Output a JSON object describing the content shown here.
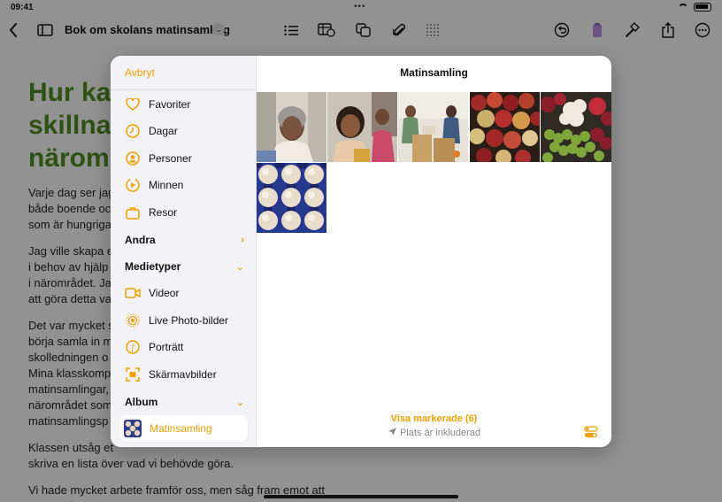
{
  "status": {
    "time": "09:41"
  },
  "toolbar": {
    "title": "Bok om skolans matinsamling",
    "icons": [
      "back-icon",
      "sidebar-icon",
      "list-icon",
      "table-icon",
      "shapes-icon",
      "paperclip-icon",
      "grid-icon",
      "undo-icon",
      "color-icon",
      "hammer-icon",
      "share-icon",
      "more-icon"
    ]
  },
  "document": {
    "heading": "Hur ka\nskillnad\nnärom",
    "paragraphs": [
      "Varje dag ser jag\nbåde boende oc\nsom är hungriga",
      "Jag ville skapa e\ni behov av hjälp\ni närområdet. Ja\natt göra detta va",
      "Det var mycket s\nbörja samla in m\nskolledningen o\nMina klasskomp\nmatinsamlingar,\nnärområdet som\nmatinsamlingsp",
      "Klassen utsåg et\nskriva en lista över vad vi behövde göra.",
      "Vi hade mycket arbete framför oss, men såg fram emot att\ngöra en insats!"
    ]
  },
  "popover": {
    "cancel_label": "Avbryt",
    "title": "Matinsamling",
    "sidebar": {
      "library_items": [
        {
          "label": "Favoriter",
          "icon": "heart-icon"
        },
        {
          "label": "Dagar",
          "icon": "clock-icon"
        },
        {
          "label": "Personer",
          "icon": "person-icon"
        },
        {
          "label": "Minnen",
          "icon": "memories-icon"
        },
        {
          "label": "Resor",
          "icon": "suitcase-icon"
        }
      ],
      "andra_label": "Andra",
      "mediatyper_label": "Medietyper",
      "media_items": [
        {
          "label": "Videor",
          "icon": "video-icon"
        },
        {
          "label": "Live Photo-bilder",
          "icon": "live-photo-icon"
        },
        {
          "label": "Porträtt",
          "icon": "portrait-icon"
        },
        {
          "label": "Skärmavbilder",
          "icon": "screenshot-icon"
        }
      ],
      "album_label": "Album",
      "album_items": [
        {
          "label": "Matinsamling",
          "icon": "album-thumbnail",
          "selected": true
        }
      ]
    },
    "photos": [
      {
        "name": "photo-woman-smiling"
      },
      {
        "name": "photo-girl-smiling"
      },
      {
        "name": "photo-volunteers-boxes"
      },
      {
        "name": "photo-apples"
      },
      {
        "name": "photo-vegetables"
      },
      {
        "name": "photo-eggs"
      }
    ],
    "footer": {
      "show_selected": "Visa markerade (6)",
      "location": "Plats är inkluderad"
    }
  },
  "colors": {
    "accent": "#f0a000",
    "heading_green": "#4b8b1e"
  }
}
